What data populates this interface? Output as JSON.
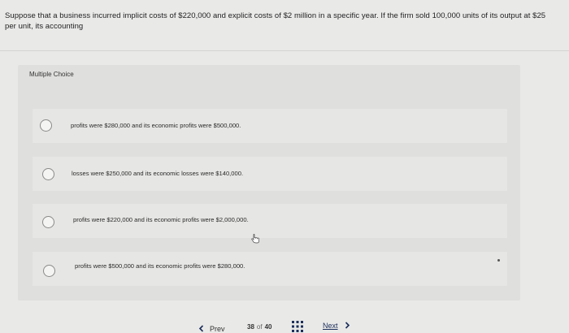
{
  "question": {
    "text": "Suppose that a business incurred implicit costs of $220,000 and explicit costs of $2 million in a specific year. If the firm sold 100,000 units of its output at $25 per unit, its accounting"
  },
  "multiple_choice": {
    "label": "Multiple Choice",
    "options": [
      {
        "text": "profits were $280,000 and its economic profits were $500,000.",
        "selected": false
      },
      {
        "text": "losses were $250,000 and its economic losses were $140,000.",
        "selected": false
      },
      {
        "text": "profits were $220,000 and its economic profits were $2,000,000.",
        "selected": false
      },
      {
        "text": "profits were $500,000 and its economic profits were $280,000.",
        "selected": false
      }
    ]
  },
  "footer": {
    "prev_label": "Prev",
    "current_page": "38",
    "of_label": "of",
    "total_pages": "40",
    "next_label": "Next"
  },
  "icons": {
    "prev": "chevron-left-icon",
    "next": "chevron-right-icon",
    "grid": "grid-icon",
    "cursor": "hand-pointer-icon"
  },
  "colors": {
    "background": "#e9e9e8",
    "panel": "#dfdfdd",
    "next_link": "#1a2d5a"
  }
}
